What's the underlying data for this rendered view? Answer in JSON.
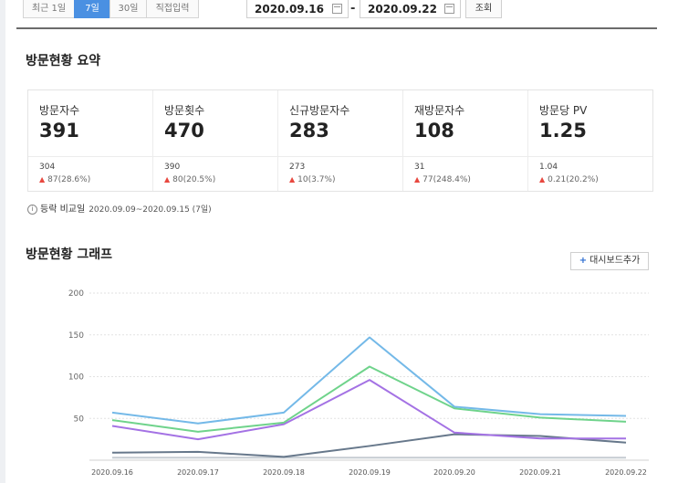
{
  "period_tabs": [
    {
      "label": "최근 1일",
      "active": false
    },
    {
      "label": "7일",
      "active": true
    },
    {
      "label": "30일",
      "active": false
    },
    {
      "label": "직접입력",
      "active": false
    }
  ],
  "date_range": {
    "start": "2020.09.16",
    "separator": "-",
    "end": "2020.09.22",
    "query_label": "조회"
  },
  "summary": {
    "title": "방문현황 요약",
    "metrics": [
      {
        "label": "방문자수",
        "value": "391",
        "previous": "304",
        "change": "87(28.6%)"
      },
      {
        "label": "방문횟수",
        "value": "470",
        "previous": "390",
        "change": "80(20.5%)"
      },
      {
        "label": "신규방문자수",
        "value": "283",
        "previous": "273",
        "change": "10(3.7%)"
      },
      {
        "label": "재방문자수",
        "value": "108",
        "previous": "31",
        "change": "77(248.4%)"
      },
      {
        "label": "방문당 PV",
        "value": "1.25",
        "previous": "1.04",
        "change": "0.21(20.2%)"
      }
    ],
    "compare_label": "등락 비교일",
    "compare_range": "2020.09.09~2020.09.15 (7일)"
  },
  "graph": {
    "title": "방문현황 그래프",
    "add_button": "대시보드추가"
  },
  "chart_data": {
    "type": "line",
    "categories": [
      "2020.09.16",
      "2020.09.17",
      "2020.09.18",
      "2020.09.19",
      "2020.09.20",
      "2020.09.21",
      "2020.09.22"
    ],
    "ylim": [
      0,
      200
    ],
    "yticks": [
      "200",
      "150",
      "100",
      "50"
    ],
    "grid": true,
    "series": [
      {
        "color": "#74b9e8",
        "values": [
          57,
          44,
          57,
          147,
          64,
          55,
          53
        ]
      },
      {
        "color": "#6fd38b",
        "values": [
          48,
          34,
          45,
          112,
          62,
          51,
          46
        ]
      },
      {
        "color": "#a472e4",
        "values": [
          41,
          25,
          43,
          96,
          33,
          26,
          26
        ]
      },
      {
        "color": "#67788b",
        "values": [
          9,
          10,
          4,
          17,
          31,
          29,
          21
        ]
      },
      {
        "color": "#c5ccd2",
        "values": [
          3,
          3,
          3,
          3,
          3,
          3,
          3
        ]
      }
    ]
  }
}
